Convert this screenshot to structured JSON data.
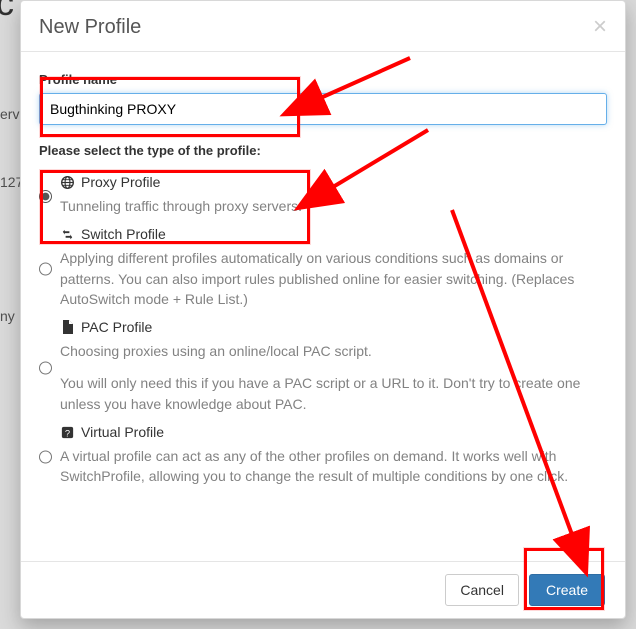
{
  "bg": {
    "left1": "erv",
    "left2": "127",
    "left3": "ny",
    "dc": "dc"
  },
  "modal": {
    "title": "New Profile",
    "close_glyph": "×",
    "name_label": "Profile name",
    "name_value": "Bugthinking PROXY",
    "type_label": "Please select the type of the profile:",
    "options": [
      {
        "key": "proxy",
        "title": "Proxy Profile",
        "icon": "globe-icon",
        "checked": true,
        "desc": "Tunneling traffic through proxy servers."
      },
      {
        "key": "switch",
        "title": "Switch Profile",
        "icon": "retweet-icon",
        "checked": false,
        "desc": "Applying different profiles automatically on various conditions such as domains or patterns. You can also import rules published online for easier switching. (Replaces AutoSwitch mode + Rule List.)"
      },
      {
        "key": "pac",
        "title": "PAC Profile",
        "icon": "file-icon",
        "checked": false,
        "desc": "Choosing proxies using an online/local PAC script.",
        "desc2": "You will only need this if you have a PAC script or a URL to it. Don't try to create one unless you have knowledge about PAC."
      },
      {
        "key": "virtual",
        "title": "Virtual Profile",
        "icon": "question-badge-icon",
        "checked": false,
        "desc": "A virtual profile can act as any of the other profiles on demand. It works well with SwitchProfile, allowing you to change the result of multiple conditions by one click."
      }
    ],
    "cancel_label": "Cancel",
    "create_label": "Create"
  },
  "annotation_color": "#ff0000"
}
